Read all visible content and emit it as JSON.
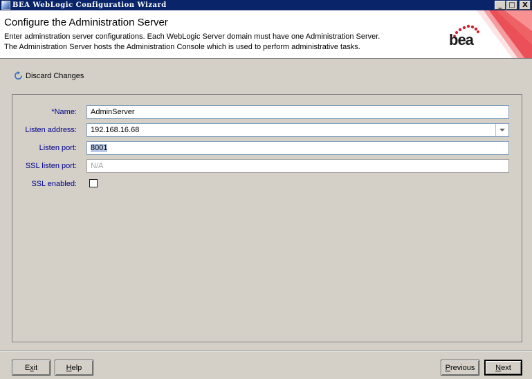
{
  "window": {
    "title": "BEA WebLogic Configuration Wizard",
    "controls": {
      "minimize": "_",
      "maximize": "□",
      "close": "X"
    }
  },
  "header": {
    "title": "Configure the Administration Server",
    "description_line1": "Enter adminstration server configurations. Each WebLogic Server domain must have one Administration Server.",
    "description_line2": "The Administration Server hosts the Administration Console which is used to perform administrative tasks.",
    "logo_text": "bea"
  },
  "discard": {
    "label": "Discard Changes",
    "icon": "refresh-icon"
  },
  "form": {
    "name": {
      "label": "*Name:",
      "value": "AdminServer"
    },
    "listen_address": {
      "label": "Listen address:",
      "value": "192.168.16.68"
    },
    "listen_port": {
      "label": "Listen port:",
      "value": "8001"
    },
    "ssl_listen_port": {
      "label": "SSL listen port:",
      "value": "N/A"
    },
    "ssl_enabled": {
      "label": "SSL enabled:",
      "checked": false
    }
  },
  "footer": {
    "exit": {
      "pre": "E",
      "mnemonic": "x",
      "post": "it"
    },
    "help": {
      "pre": "",
      "mnemonic": "H",
      "post": "elp"
    },
    "previous": {
      "pre": "",
      "mnemonic": "P",
      "post": "revious"
    },
    "next": {
      "pre": "",
      "mnemonic": "N",
      "post": "ext"
    }
  },
  "colors": {
    "titlebar": "#0a246a",
    "label": "#00008b",
    "background": "#d4d0c8",
    "logo_red": "#e0202a"
  }
}
